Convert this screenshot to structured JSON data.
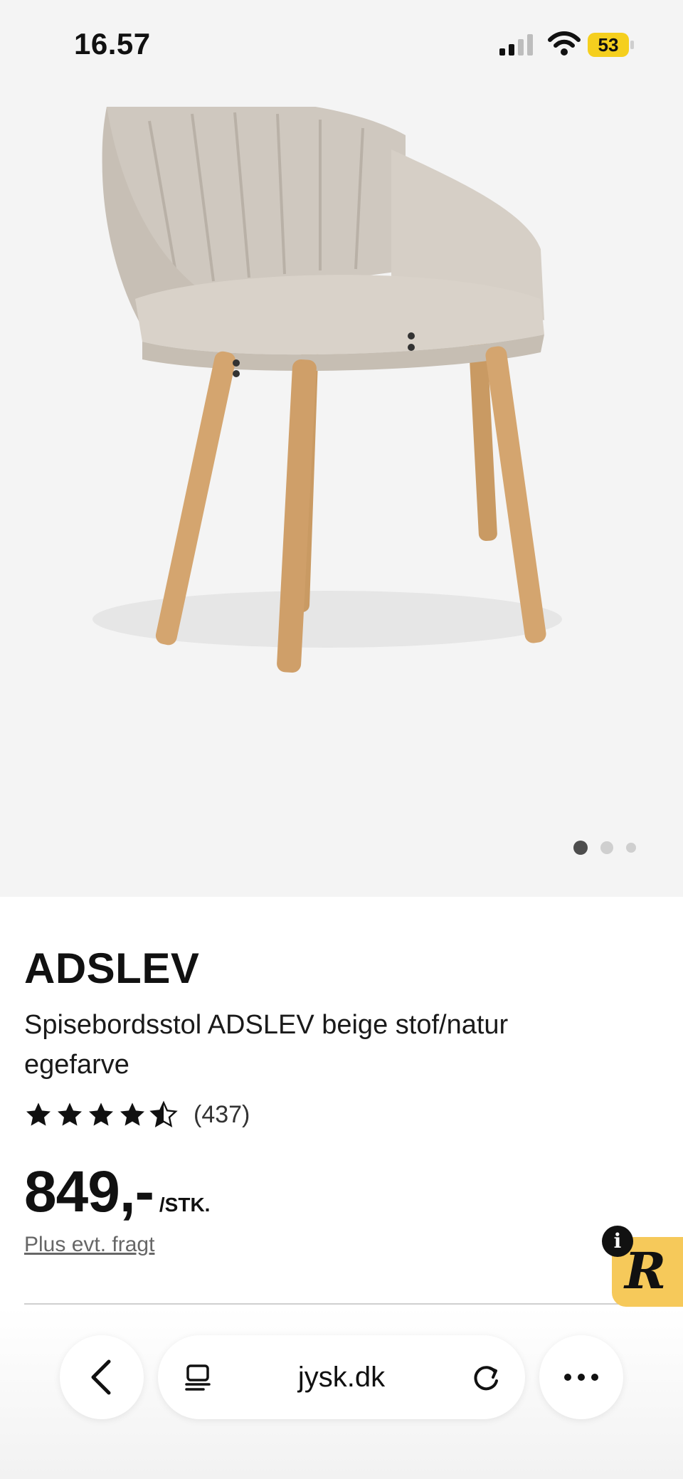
{
  "status_bar": {
    "time": "16.57",
    "battery": "53"
  },
  "product": {
    "brand": "ADSLEV",
    "description": "Spisebordsstol ADSLEV beige stof/natur egefarve",
    "rating": 4.5,
    "rating_count": "(437)",
    "price": "849,-",
    "unit": "/STK.",
    "shipping_note": "Plus evt. fragt"
  },
  "gallery": {
    "image_count": 3,
    "active_index": 0
  },
  "browser": {
    "url": "jysk.dk"
  },
  "icons": [
    "signal-icon",
    "wifi-icon",
    "battery-icon",
    "chevron-left-icon",
    "tabs-icon",
    "reload-icon",
    "more-icon",
    "star-icon",
    "info-icon"
  ],
  "colors": {
    "badge_yellow": "#f6c95a",
    "gallery_bg": "#f4f4f4",
    "text": "#111111"
  }
}
